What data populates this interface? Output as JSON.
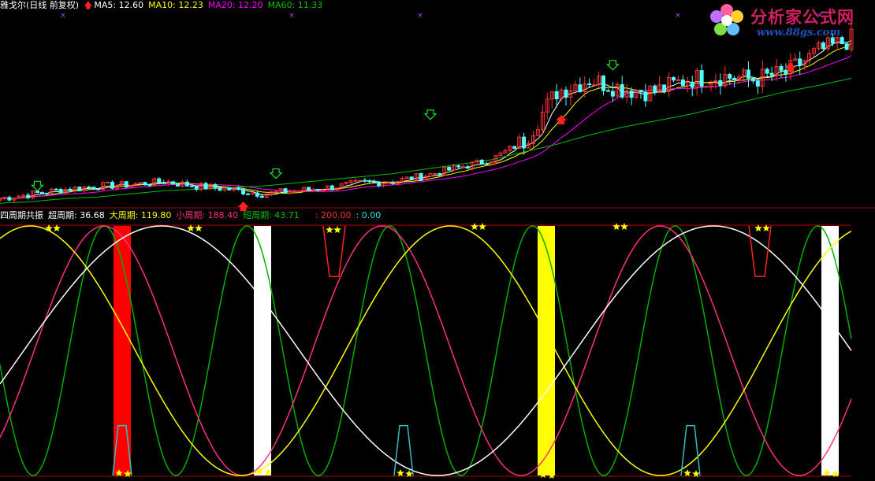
{
  "header": {
    "stock_name": "雅戈尔(日线 前复权)",
    "ma5": "MA5: 12.60",
    "ma10": "MA10: 12.23",
    "ma20": "MA20: 12.20",
    "ma60": "MA60: 11.33"
  },
  "indicator_header": {
    "name": "四周期共振",
    "super": "超周期: 36.68",
    "big": "大周期: 119.80",
    "small": "小周期: 188.40",
    "short": "短周期: 43.71",
    "upper": ": 200.00",
    "lower": ": 0.00"
  },
  "logo": {
    "brand": "分析家公式网",
    "url": "www.88gs.com"
  },
  "colors": {
    "background": "#000000",
    "up_candle": "#ff3232",
    "down_candle": "#54ffff",
    "ma5": "#ffffff",
    "ma10": "#ffff00",
    "ma20": "#ff00ff",
    "ma60": "#00c000",
    "super_cycle": "#ffffff",
    "big_cycle": "#ffff00",
    "small_cycle": "#ff3080",
    "short_cycle": "#00b000",
    "red_bar": "#ff0000",
    "white_bar": "#ffffff",
    "yellow_bar": "#ffff00"
  },
  "chart_data": [
    {
      "type": "candlestick",
      "title": "雅戈尔(日线 前复权)",
      "series": [
        {
          "name": "MA5",
          "value": 12.6
        },
        {
          "name": "MA10",
          "value": 12.23
        },
        {
          "name": "MA20",
          "value": 12.2
        },
        {
          "name": "MA60",
          "value": 11.33
        }
      ],
      "x": [
        0,
        7,
        14,
        21,
        28,
        35,
        42,
        49,
        56,
        63,
        70,
        77,
        84,
        91,
        98,
        105,
        112,
        119,
        126,
        133,
        140,
        147,
        154,
        161,
        168,
        175,
        182
      ],
      "close": [
        7.45,
        7.6,
        7.75,
        7.85,
        7.9,
        8.0,
        7.85,
        7.75,
        7.6,
        7.7,
        7.8,
        7.95,
        8.0,
        8.2,
        8.45,
        8.7,
        9.3,
        10.9,
        11.3,
        11.0,
        10.9,
        11.3,
        11.4,
        11.3,
        11.5,
        12.2,
        12.6
      ],
      "ma60_path": [
        7.3,
        7.35,
        7.45,
        7.5,
        7.6,
        7.7,
        7.75,
        7.8,
        7.85,
        7.95,
        8.05,
        8.15,
        8.25,
        8.4,
        8.55,
        8.7,
        8.95,
        9.2,
        9.5,
        9.75,
        9.95,
        10.15,
        10.4,
        10.65,
        10.9,
        11.1,
        11.33
      ],
      "buy_markers": [
        [
          8,
          7.65
        ],
        [
          59,
          8.05
        ],
        [
          92,
          9.95
        ],
        [
          131,
          11.55
        ]
      ],
      "sell_markers": [
        [
          52,
          7.45
        ],
        [
          120,
          10.25
        ],
        [
          169,
          11.95
        ]
      ],
      "ylim": [
        7.2,
        13.4
      ],
      "xlim": [
        0,
        182
      ]
    },
    {
      "type": "line",
      "title": "四周期共振",
      "ylim": [
        0,
        200
      ],
      "xlim": [
        0,
        1080
      ],
      "series": [
        {
          "name": "超周期",
          "color": "#ffffff",
          "period": 700,
          "phase": -300,
          "value": 36.68
        },
        {
          "name": "大周期",
          "color": "#ffff00",
          "period": 533,
          "phase": 150,
          "value": 119.8
        },
        {
          "name": "小周期",
          "color": "#ff3080",
          "period": 353,
          "phase": -200,
          "value": 188.4
        },
        {
          "name": "短周期",
          "color": "#00b000",
          "period": 181,
          "phase": 68,
          "value": 43.71
        }
      ],
      "bars": [
        {
          "x": 155,
          "color": "#ff0000"
        },
        {
          "x": 333,
          "color": "#ffffff"
        },
        {
          "x": 693,
          "color": "#ffff00"
        },
        {
          "x": 1053,
          "color": "#ffffff"
        }
      ],
      "red_pulses": [
        [
          424,
          110
        ],
        [
          964,
          110
        ]
      ],
      "cyan_pulses": [
        [
          155,
          40
        ],
        [
          512,
          40
        ],
        [
          876,
          40
        ]
      ]
    }
  ]
}
